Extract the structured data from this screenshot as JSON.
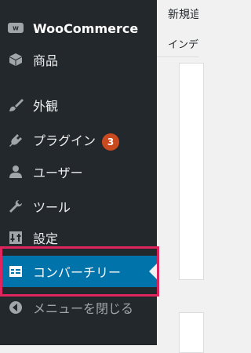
{
  "sidebar": {
    "items": [
      {
        "label": "WooCommerce",
        "icon": "woo-icon"
      },
      {
        "label": "商品",
        "icon": "box-icon"
      },
      {
        "label": "外観",
        "icon": "brush-icon"
      },
      {
        "label": "プラグイン",
        "icon": "plugin-icon",
        "badge": "3"
      },
      {
        "label": "ユーザー",
        "icon": "user-icon"
      },
      {
        "label": "ツール",
        "icon": "wrench-icon"
      },
      {
        "label": "設定",
        "icon": "settings-icon"
      },
      {
        "label": "コンバーチリー",
        "icon": "table-icon"
      },
      {
        "label": "メニューを閉じる",
        "icon": "collapse-icon"
      }
    ]
  },
  "topbar": {
    "line1": "新規追",
    "line2": "インデ"
  },
  "colors": {
    "sidebar_bg": "#23282d",
    "current_bg": "#0073aa",
    "badge": "#ca4a1f",
    "highlight": "#e0245e"
  }
}
